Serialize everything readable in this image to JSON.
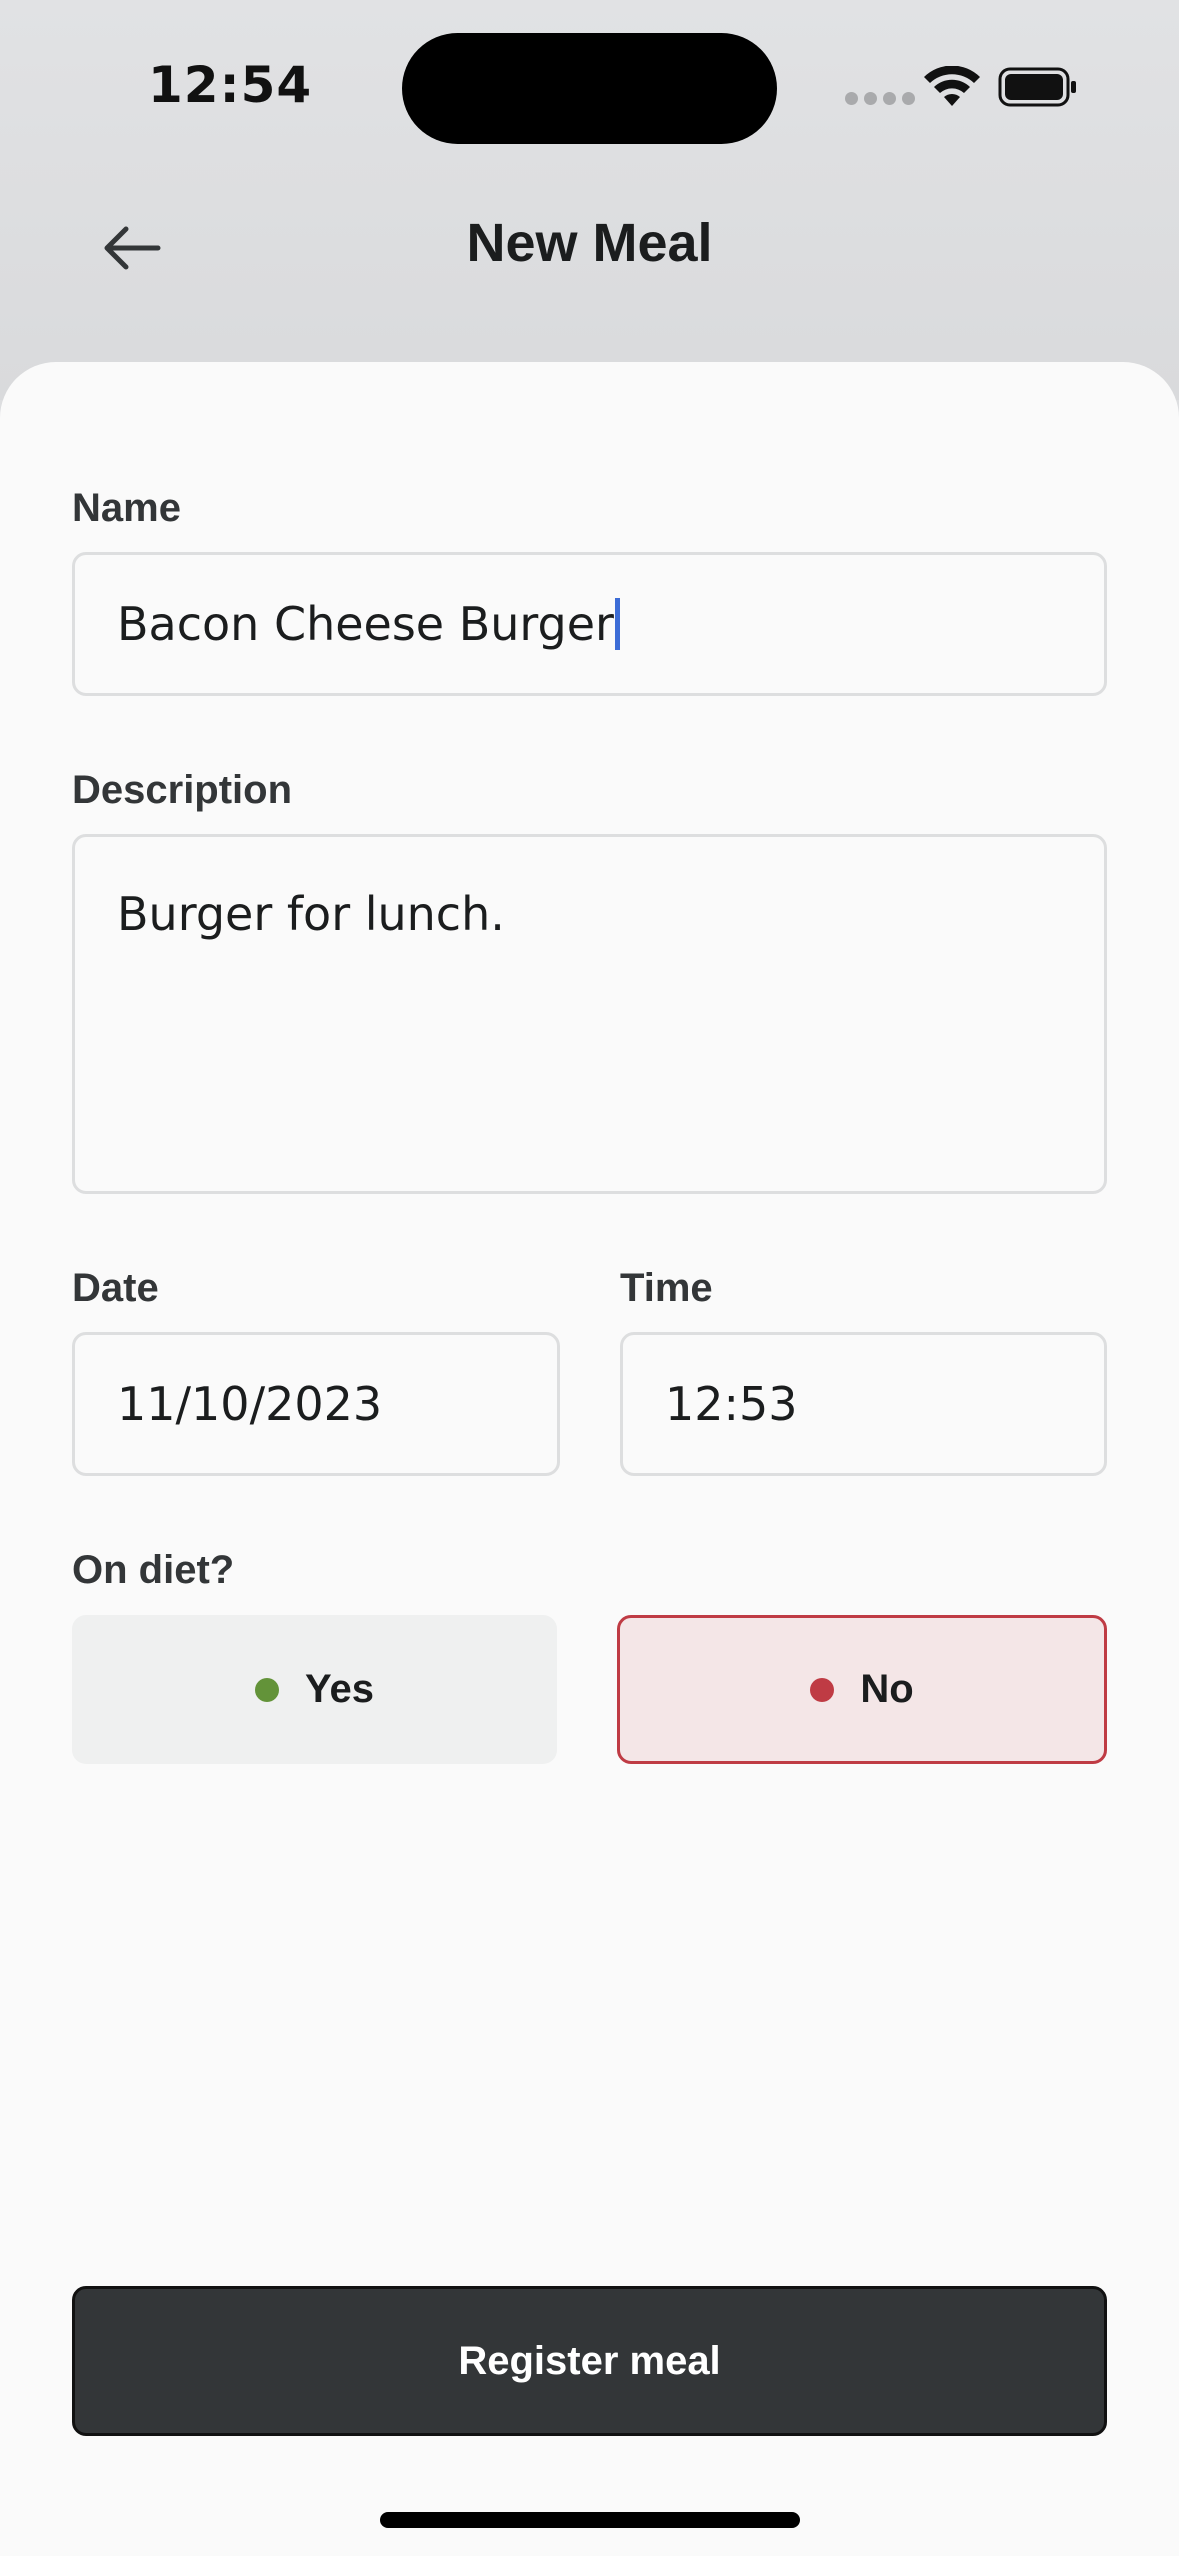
{
  "status_bar": {
    "time": "12:54"
  },
  "header": {
    "title": "New Meal",
    "back_icon": "arrow-left-icon"
  },
  "form": {
    "name": {
      "label": "Name",
      "value": "Bacon Cheese Burger"
    },
    "description": {
      "label": "Description",
      "value": "Burger for lunch."
    },
    "date": {
      "label": "Date",
      "value": "11/10/2023"
    },
    "time": {
      "label": "Time",
      "value": "12:53"
    },
    "on_diet": {
      "label": "On diet?",
      "yes_label": "Yes",
      "no_label": "No",
      "selected": "No",
      "colors": {
        "yes_dot": "#639339",
        "no_dot": "#bf3b44",
        "no_border": "#bf3b44",
        "no_bg": "#f4e6e7"
      }
    }
  },
  "actions": {
    "register_label": "Register meal"
  },
  "colors": {
    "accent_dark": "#333638",
    "cursor": "#3c6cd6"
  }
}
